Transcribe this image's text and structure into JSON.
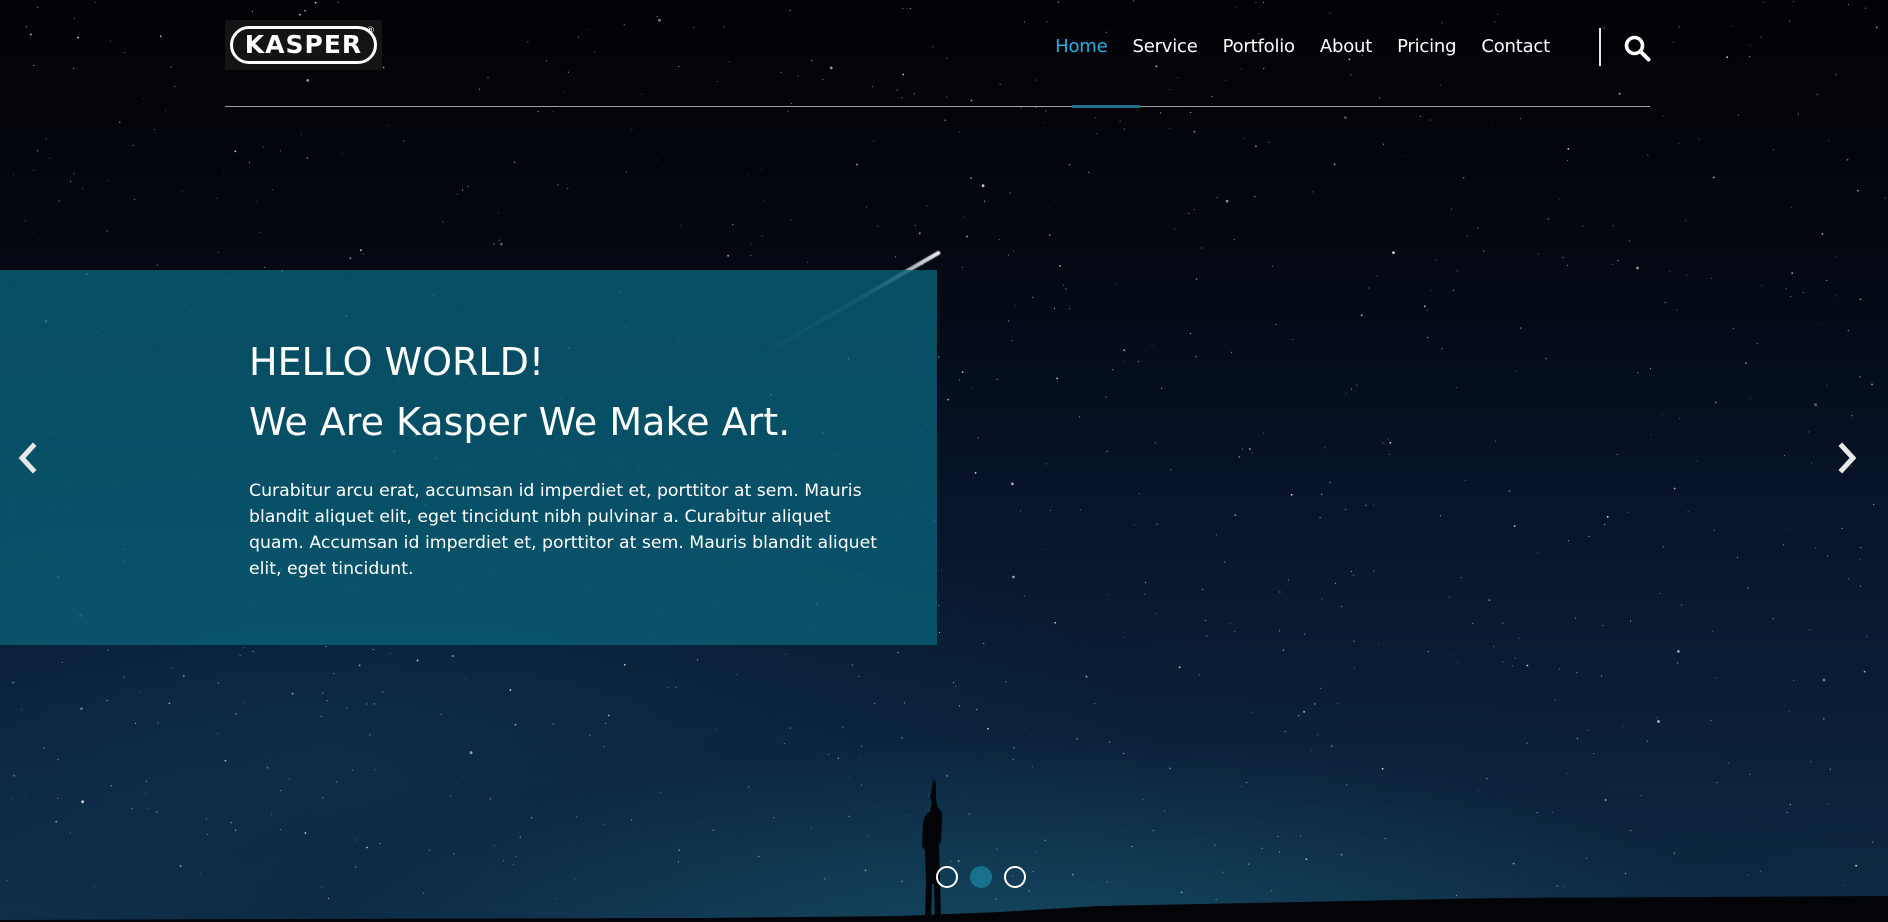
{
  "brand": {
    "logo_text": "KASPER",
    "reg_mark": "®",
    "accent_color": "#2ab0e4"
  },
  "nav": {
    "items": [
      {
        "label": "Home",
        "active": true
      },
      {
        "label": "Service",
        "active": false
      },
      {
        "label": "Portfolio",
        "active": false
      },
      {
        "label": "About",
        "active": false
      },
      {
        "label": "Pricing",
        "active": false
      },
      {
        "label": "Contact",
        "active": false
      }
    ],
    "search_icon": "search-icon"
  },
  "slide": {
    "title_line1": "HELLO WORLD!",
    "title_line2": "We Are Kasper We Make Art.",
    "body": "Curabitur arcu erat, accumsan id imperdiet et, porttitor at sem. Mauris blandit aliquet elit, eget tincidunt nibh pulvinar a. Curabitur aliquet quam. Accumsan id imperdiet et, porttitor at sem. Mauris blandit aliquet elit, eget tincidunt.",
    "caption_color": "#086278"
  },
  "carousel": {
    "prev_icon": "chevron-left-icon",
    "next_icon": "chevron-right-icon",
    "dots_total": 3,
    "active_dot": 2
  }
}
